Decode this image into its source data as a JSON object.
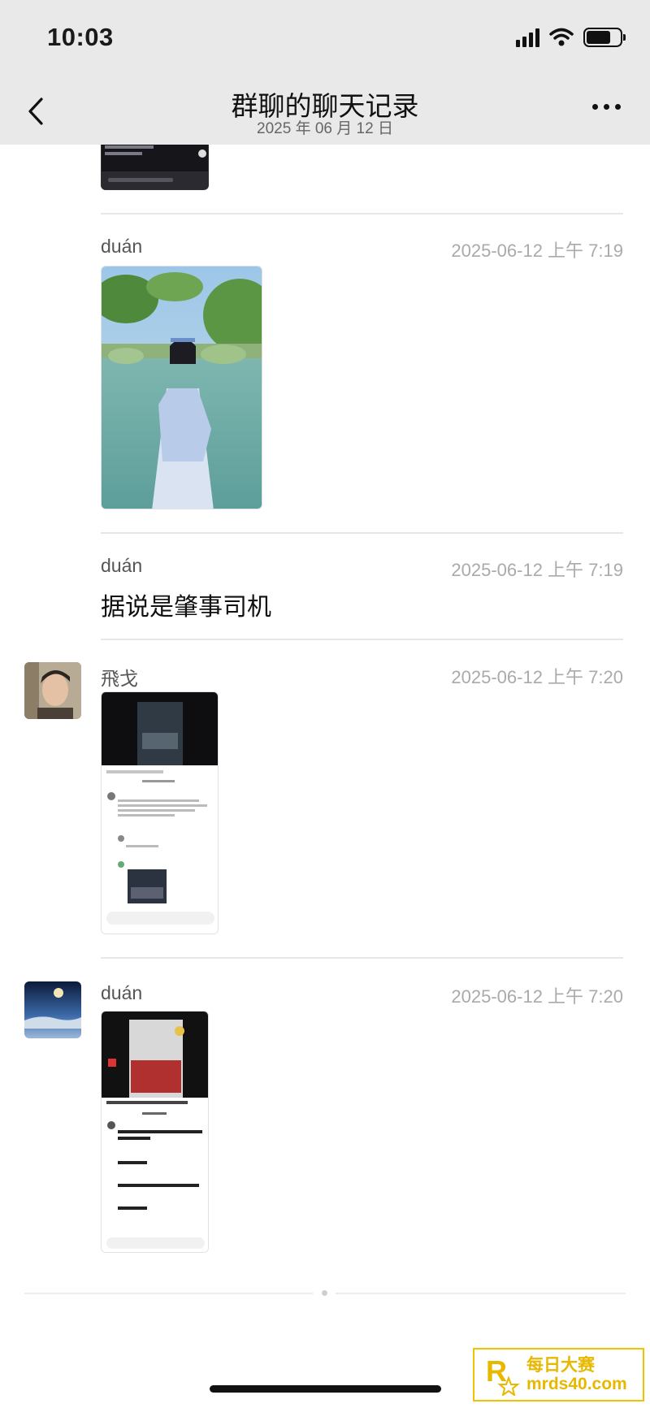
{
  "status_bar": {
    "time": "10:03"
  },
  "header": {
    "title": "群聊的聊天记录",
    "subtitle": "2025 年 06 月 12 日"
  },
  "messages": [
    {
      "sender": "duán",
      "time": "2025-06-12 上午 7:19",
      "type": "image"
    },
    {
      "sender": "duán",
      "time": "2025-06-12 上午 7:19",
      "type": "text",
      "text": "据说是肇事司机"
    },
    {
      "sender": "飛戈",
      "time": "2025-06-12 上午 7:20",
      "type": "image"
    },
    {
      "sender": "duán",
      "time": "2025-06-12 上午 7:20",
      "type": "image"
    }
  ],
  "watermark": {
    "line1": "每日大赛",
    "line2": "mrds40.com"
  },
  "colors": {
    "header_bg": "#e9e9e9",
    "watermark": "#e8b800"
  }
}
